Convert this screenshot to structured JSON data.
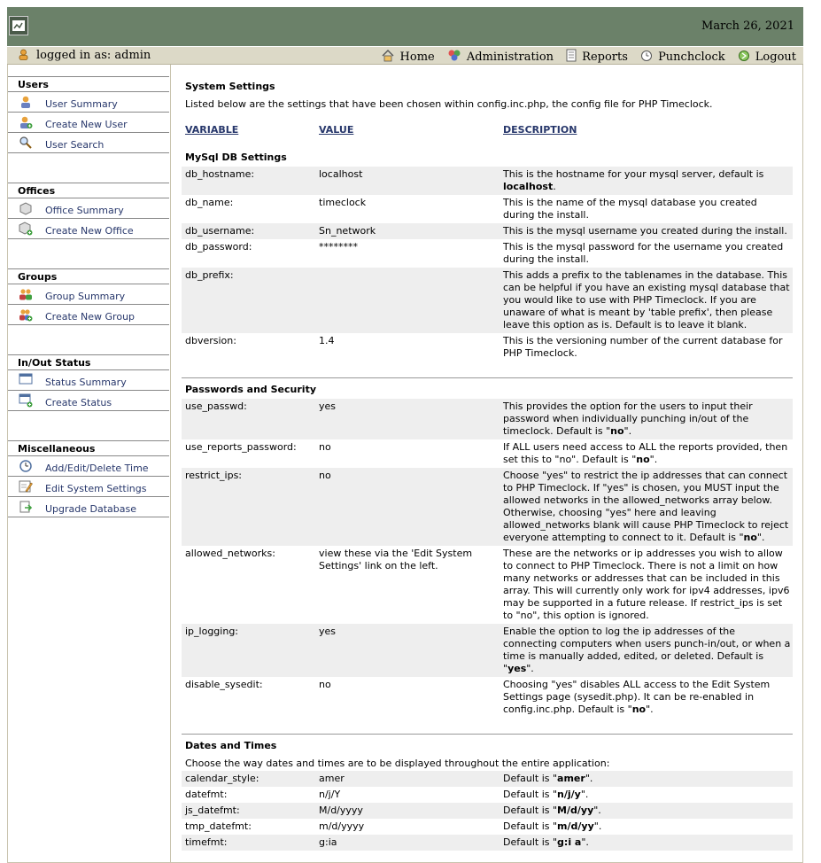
{
  "header": {
    "date": "March 26, 2021"
  },
  "navbar": {
    "logged_in": "logged in as: admin",
    "links": [
      {
        "label": "Home",
        "icon": "home-icon"
      },
      {
        "label": "Administration",
        "icon": "administration-icon"
      },
      {
        "label": "Reports",
        "icon": "reports-icon"
      },
      {
        "label": "Punchclock",
        "icon": "clock-icon"
      },
      {
        "label": "Logout",
        "icon": "logout-icon"
      }
    ]
  },
  "sidebar": {
    "sections": [
      {
        "title": "Users",
        "items": [
          {
            "label": "User Summary",
            "icon": "user-icon"
          },
          {
            "label": "Create New User",
            "icon": "add-user-icon"
          },
          {
            "label": "User Search",
            "icon": "search-icon"
          }
        ]
      },
      {
        "title": "Offices",
        "items": [
          {
            "label": "Office Summary",
            "icon": "office-icon"
          },
          {
            "label": "Create New Office",
            "icon": "add-office-icon"
          }
        ]
      },
      {
        "title": "Groups",
        "items": [
          {
            "label": "Group Summary",
            "icon": "group-icon"
          },
          {
            "label": "Create New Group",
            "icon": "add-group-icon"
          }
        ]
      },
      {
        "title": "In/Out Status",
        "items": [
          {
            "label": "Status Summary",
            "icon": "status-icon"
          },
          {
            "label": "Create Status",
            "icon": "add-status-icon"
          }
        ]
      },
      {
        "title": "Miscellaneous",
        "items": [
          {
            "label": "Add/Edit/Delete Time",
            "icon": "time-icon"
          },
          {
            "label": "Edit System Settings",
            "icon": "settings-edit-icon"
          },
          {
            "label": "Upgrade Database",
            "icon": "database-upgrade-icon"
          }
        ]
      }
    ]
  },
  "main": {
    "title": "System Settings",
    "intro": "Listed below are the settings that have been chosen within config.inc.php, the config file for PHP Timeclock.",
    "columns": {
      "variable": "VARIABLE",
      "value": "VALUE",
      "description": "DESCRIPTION"
    },
    "sections": [
      {
        "title": "MySql DB Settings",
        "rows": [
          {
            "var": "db_hostname:",
            "val": "localhost",
            "desc": "This is the hostname for your mysql server, default is",
            "bold": "localhost",
            "after": "."
          },
          {
            "var": "db_name:",
            "val": "timeclock",
            "desc": "This is the name of the mysql database you created during the install.",
            "bold": "",
            "after": ""
          },
          {
            "var": "db_username:",
            "val": "Sn_network",
            "desc": "This is the mysql username you created during the install.",
            "bold": "",
            "after": ""
          },
          {
            "var": "db_password:",
            "val": "********",
            "desc": "This is the mysql password for the username you created during the install.",
            "bold": "",
            "after": ""
          },
          {
            "var": "db_prefix:",
            "val": "",
            "desc": "This adds a prefix to the tablenames in the database. This can be helpful if you have an existing mysql database that you would like to use with PHP Timeclock. If you are unaware of what is meant by 'table prefix', then please leave this option as is. Default is to leave it blank.",
            "bold": "",
            "after": ""
          },
          {
            "var": "dbversion:",
            "val": "1.4",
            "desc": "This is the versioning number of the current database for PHP Timeclock.",
            "bold": "",
            "after": ""
          }
        ]
      },
      {
        "title": "Passwords and Security",
        "rows": [
          {
            "var": "use_passwd:",
            "val": "yes",
            "desc": "This provides the option for the users to input their password when individually punching in/out of the timeclock. Default is \"",
            "bold": "no",
            "after": "\"."
          },
          {
            "var": "use_reports_password:",
            "val": "no",
            "desc": "If ALL users need access to ALL the reports provided, then set this to \"no\". Default is \"",
            "bold": "no",
            "after": "\"."
          },
          {
            "var": "restrict_ips:",
            "val": "no",
            "desc": "Choose \"yes\" to restrict the ip addresses that can connect to PHP Timeclock. If \"yes\" is chosen, you MUST input the allowed networks in the allowed_networks array below. Otherwise, choosing \"yes\" here and leaving allowed_networks blank will cause PHP Timeclock to reject everyone attempting to connect to it. Default is \"",
            "bold": "no",
            "after": "\"."
          },
          {
            "var": "allowed_networks:",
            "val": "view these via the 'Edit System Settings' link on the left.",
            "desc": "These are the networks or ip addresses you wish to allow to connect to PHP Timeclock. There is not a limit on how many networks or addresses that can be included in this array. This will currently only work for ipv4 addresses, ipv6 may be supported in a future release. If restrict_ips is set to \"no\", this option is ignored.",
            "bold": "",
            "after": ""
          },
          {
            "var": "ip_logging:",
            "val": "yes",
            "desc": "Enable the option to log the ip addresses of the connecting computers when users punch-in/out, or when a time is manually added, edited, or deleted. Default is \"",
            "bold": "yes",
            "after": "\"."
          },
          {
            "var": "disable_sysedit:",
            "val": "no",
            "desc": "Choosing \"yes\" disables ALL access to the Edit System Settings page (sysedit.php). It can be re-enabled in config.inc.php. Default is \"",
            "bold": "no",
            "after": "\"."
          }
        ]
      },
      {
        "title": "Dates and Times",
        "subtitle": "Choose the way dates and times are to be displayed throughout the entire application:",
        "rows": [
          {
            "var": "calendar_style:",
            "val": "amer",
            "desc": "Default is \"",
            "bold": "amer",
            "after": "\"."
          },
          {
            "var": "datefmt:",
            "val": "n/j/Y",
            "desc": "Default is \"",
            "bold": "n/j/y",
            "after": "\"."
          },
          {
            "var": "js_datefmt:",
            "val": "M/d/yyyy",
            "desc": "Default is \"",
            "bold": "M/d/yy",
            "after": "\"."
          },
          {
            "var": "tmp_datefmt:",
            "val": "m/d/yyyy",
            "desc": "Default is \"",
            "bold": "m/d/yy",
            "after": "\"."
          },
          {
            "var": "timefmt:",
            "val": "g:ia",
            "desc": "Default is \"",
            "bold": "g:i a",
            "after": "\"."
          }
        ]
      }
    ]
  }
}
